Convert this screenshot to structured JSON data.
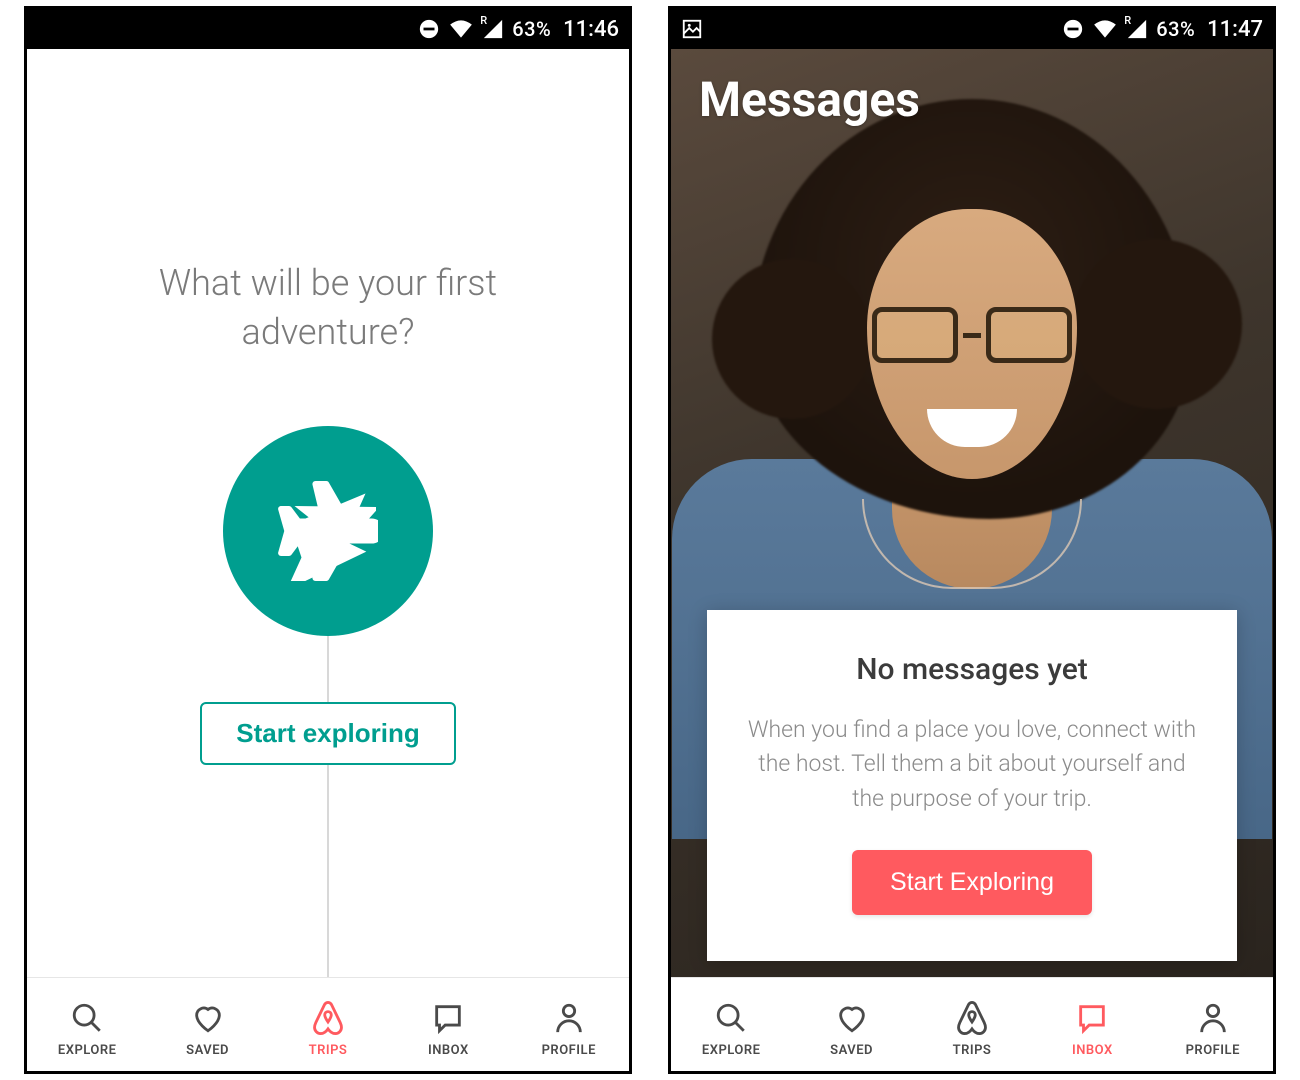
{
  "screens": [
    {
      "status_bar": {
        "battery": "63%",
        "clock": "11:46",
        "signal_label": "R"
      },
      "trips": {
        "prompt": "What will be your first adventure?",
        "button_label": "Start exploring"
      },
      "nav": {
        "items": [
          {
            "label": "EXPLORE",
            "icon": "search"
          },
          {
            "label": "SAVED",
            "icon": "heart"
          },
          {
            "label": "TRIPS",
            "icon": "airbnb"
          },
          {
            "label": "INBOX",
            "icon": "chat"
          },
          {
            "label": "PROFILE",
            "icon": "person"
          }
        ],
        "active_index": 2
      }
    },
    {
      "status_bar": {
        "battery": "63%",
        "clock": "11:47",
        "signal_label": "R"
      },
      "inbox": {
        "title": "Messages",
        "card_title": "No messages yet",
        "card_body": "When you find a place you love, connect with the host. Tell them a bit about yourself and the purpose of your trip.",
        "button_label": "Start Exploring"
      },
      "nav": {
        "items": [
          {
            "label": "EXPLORE",
            "icon": "search"
          },
          {
            "label": "SAVED",
            "icon": "heart"
          },
          {
            "label": "TRIPS",
            "icon": "airbnb"
          },
          {
            "label": "INBOX",
            "icon": "chat"
          },
          {
            "label": "PROFILE",
            "icon": "person"
          }
        ],
        "active_index": 3
      }
    }
  ]
}
